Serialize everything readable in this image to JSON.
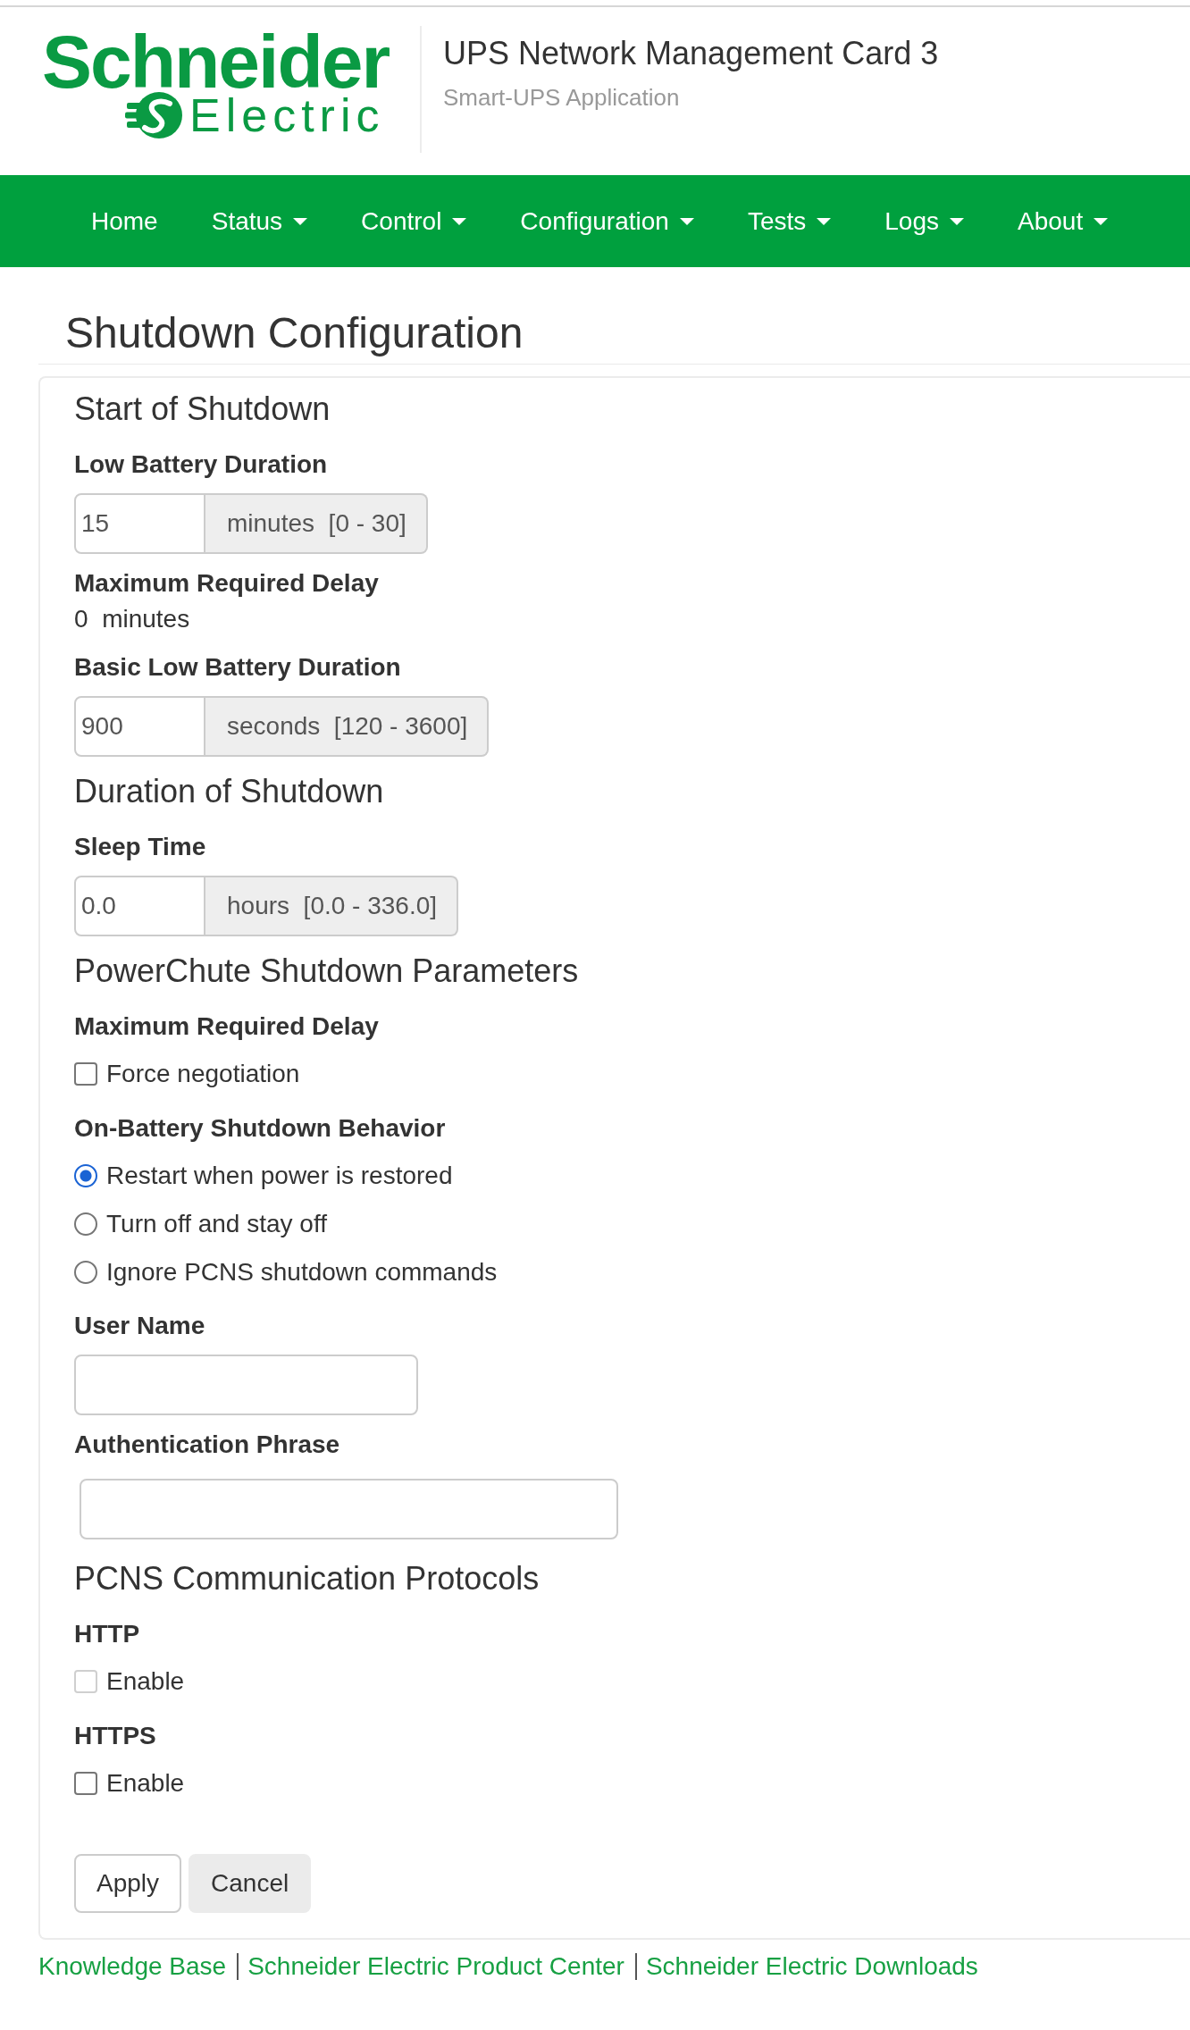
{
  "header": {
    "logo": {
      "wordmark": "Schneider",
      "tagline": "Electric"
    },
    "title": "UPS Network Management Card 3",
    "subtitle": "Smart-UPS Application"
  },
  "nav": [
    {
      "label": "Home",
      "dropdown": false
    },
    {
      "label": "Status",
      "dropdown": true
    },
    {
      "label": "Control",
      "dropdown": true
    },
    {
      "label": "Configuration",
      "dropdown": true
    },
    {
      "label": "Tests",
      "dropdown": true
    },
    {
      "label": "Logs",
      "dropdown": true
    },
    {
      "label": "About",
      "dropdown": true
    }
  ],
  "page_title": "Shutdown Configuration",
  "sections": [
    {
      "heading": "Start of Shutdown",
      "fields": [
        {
          "kind": "number",
          "label": "Low Battery Duration",
          "value": "15",
          "addon": "minutes  [0 - 30]"
        },
        {
          "kind": "readout",
          "label": "Maximum Required Delay",
          "value": "0  minutes"
        },
        {
          "kind": "number",
          "label": "Basic Low Battery Duration",
          "value": "900",
          "addon": "seconds  [120 - 3600]"
        }
      ]
    },
    {
      "heading": "Duration of Shutdown",
      "fields": [
        {
          "kind": "number",
          "label": "Sleep Time",
          "value": "0.0",
          "addon": "hours  [0.0 - 336.0]"
        }
      ]
    },
    {
      "heading": "PowerChute Shutdown Parameters",
      "fields": [
        {
          "kind": "checkbox",
          "label": "Maximum Required Delay",
          "options": [
            {
              "label": "Force negotiation",
              "checked": false,
              "disabled": false
            }
          ]
        },
        {
          "kind": "radio",
          "label": "On-Battery Shutdown Behavior",
          "options": [
            {
              "label": "Restart when power is restored",
              "selected": true
            },
            {
              "label": "Turn off and stay off",
              "selected": false
            },
            {
              "label": "Ignore PCNS shutdown commands",
              "selected": false
            }
          ]
        },
        {
          "kind": "text",
          "label": "User Name"
        },
        {
          "kind": "password",
          "label": "Authentication Phrase"
        }
      ]
    },
    {
      "heading": "PCNS Communication Protocols",
      "fields": [
        {
          "kind": "checkbox",
          "label": "HTTP",
          "options": [
            {
              "label": "Enable",
              "checked": false,
              "disabled": true
            }
          ]
        },
        {
          "kind": "checkbox",
          "label": "HTTPS",
          "options": [
            {
              "label": "Enable",
              "checked": false,
              "disabled": false
            }
          ]
        }
      ]
    }
  ],
  "buttons": [
    {
      "label": "Apply",
      "kind": "outlined"
    },
    {
      "label": "Cancel",
      "kind": "filled"
    }
  ],
  "footer_links": [
    "Knowledge Base",
    "Schneider Electric Product Center",
    "Schneider Electric Downloads"
  ]
}
